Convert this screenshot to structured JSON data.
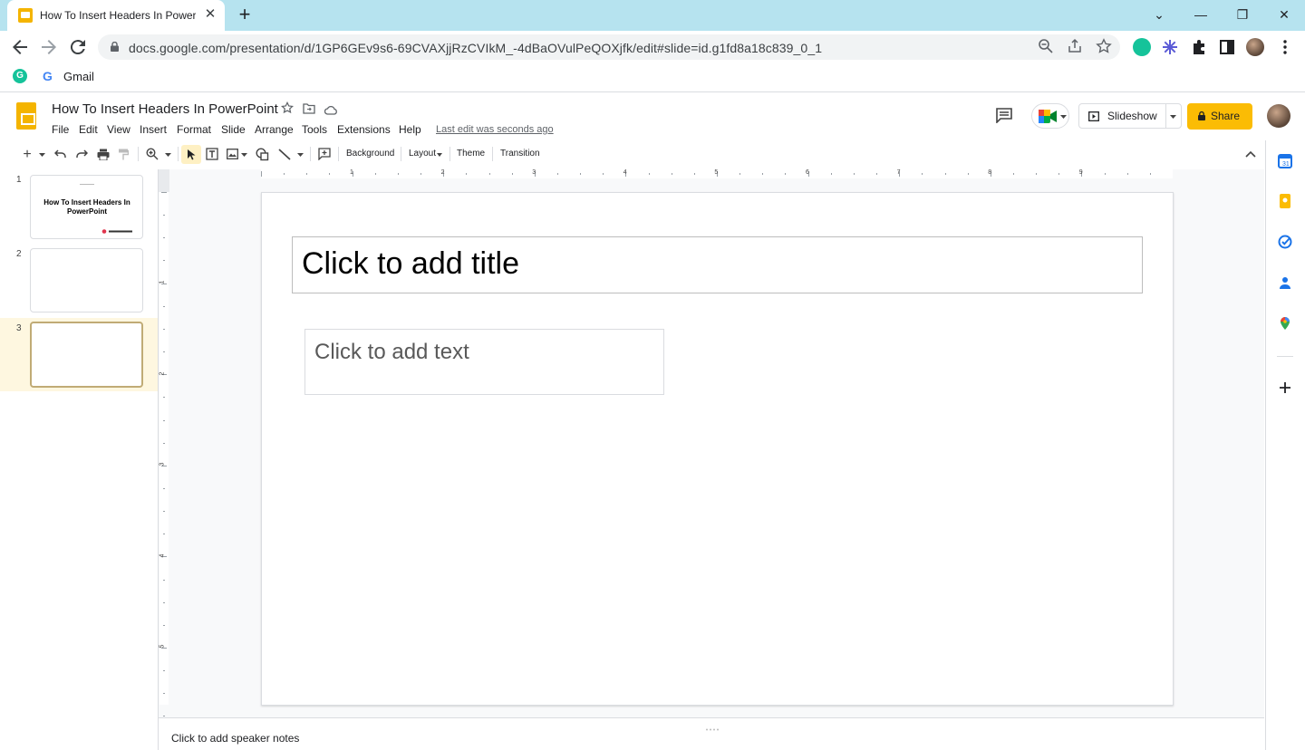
{
  "browser": {
    "tab_title": "How To Insert Headers In PowerPoint",
    "tab_close": "✕",
    "new_tab": "+",
    "window_buttons": [
      "⌄",
      "—",
      "❐",
      "✕"
    ],
    "url": "docs.google.com/presentation/d/1GP6GEv9s6-69CVAXjjRzCVIkM_-4dBaOVulPeQOXjfk/edit#slide=id.g1fd8a18c839_0_1",
    "bookmarks": [
      {
        "icon": "grammarly-icon",
        "label": ""
      },
      {
        "icon": "google-g-icon",
        "label": "Gmail"
      }
    ]
  },
  "app": {
    "title": "How To Insert Headers In PowerPoint",
    "menus": [
      "File",
      "Edit",
      "View",
      "Insert",
      "Format",
      "Slide",
      "Arrange",
      "Tools",
      "Extensions",
      "Help"
    ],
    "last_edit": "Last edit was seconds ago",
    "slideshow_label": "Slideshow",
    "share_label": "Share"
  },
  "toolbar": {
    "background": "Background",
    "layout": "Layout",
    "theme": "Theme",
    "transition": "Transition"
  },
  "ruler": {
    "top_numbers": [
      "1",
      "2",
      "3",
      "4",
      "5",
      "6",
      "7",
      "8",
      "9"
    ],
    "left_numbers": [
      "1",
      "2",
      "3",
      "4",
      "5"
    ]
  },
  "filmstrip": {
    "slides": [
      {
        "number": "1",
        "title": "How To Insert Headers In PowerPoint"
      },
      {
        "number": "2",
        "title": ""
      },
      {
        "number": "3",
        "title": ""
      }
    ],
    "selected": 3
  },
  "slide": {
    "title_placeholder": "Click to add title",
    "body_placeholder": "Click to add text"
  },
  "notes": {
    "placeholder": "Click to add speaker notes"
  },
  "colors": {
    "tabstrip": "#b6e3ef",
    "share": "#fbbc04",
    "slides_brand": "#f4b400",
    "selected_slide_bg": "#fef7e0"
  }
}
